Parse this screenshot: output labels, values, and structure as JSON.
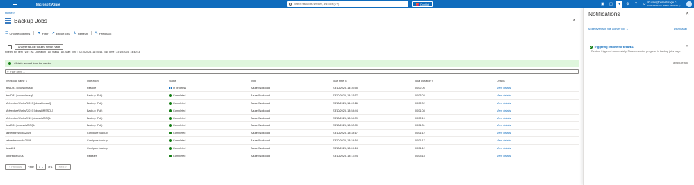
{
  "topbar": {
    "brand": "Microsoft Azure",
    "search_placeholder": "Search resources, services, and docs (G+/)",
    "copilot_label": "Copilot",
    "account_name": "oburski@purestorage.c...",
    "account_org": "PURE STORAGE (PSTSLOMNNTO...)"
  },
  "breadcrumb": "Home >",
  "page": {
    "title": "Backup Jobs",
    "more": "…"
  },
  "toolbar": {
    "choose_columns": "Choose columns",
    "filter": "Filter",
    "export_jobs": "Export jobs",
    "refresh": "Refresh",
    "feedback": "Feedback"
  },
  "analyze_label": "Analyze all Job failures for this vault",
  "filter_summary": "Filtered by: Item Type : All, Operation : All, Status : All, Start Time : 22/10/2025, 14:40:43, End Time : 23/10/2025, 14:40:43",
  "info_message": "All data fetched from the service.",
  "filter_placeholder": "Filter items ...",
  "table": {
    "headers": [
      "Workload name",
      "Operation",
      "Status",
      "Type",
      "Start time",
      "Total Duration",
      "Details"
    ],
    "rows": [
      {
        "name": "testDB1 [oburskimssql]",
        "operation": "Restore",
        "status": "In progress",
        "status_kind": "progress",
        "type": "Azure Workload",
        "start": "23/10/2025, 14:39:55",
        "duration": "00:02:06",
        "details": "View details"
      },
      {
        "name": "testDB1 [oburskimssql]",
        "operation": "Backup (Full)",
        "status": "Completed",
        "status_kind": "ok",
        "type": "Azure Workload",
        "start": "23/10/2025, 14:31:57",
        "duration": "00:03:03",
        "details": "View details"
      },
      {
        "name": "AdventureWorks72019 [oburskimssql]",
        "operation": "Backup (Full)",
        "status": "Completed",
        "status_kind": "ok",
        "type": "Azure Workload",
        "start": "23/10/2025, 14:09:16",
        "duration": "00:02:02",
        "details": "View details"
      },
      {
        "name": "AdventureWorks72019 [oburskiMSSQL]",
        "operation": "Backup (Full)",
        "status": "Completed",
        "status_kind": "ok",
        "type": "Azure Workload",
        "start": "23/10/2025, 13:54:44",
        "duration": "00:01:08",
        "details": "View details"
      },
      {
        "name": "AdventureWorks2019 [oburskiMSSQL]",
        "operation": "Backup (Full)",
        "status": "Completed",
        "status_kind": "ok",
        "type": "Azure Workload",
        "start": "23/10/2025, 13:54:39",
        "duration": "00:02:19",
        "details": "View details"
      },
      {
        "name": "testDB1 [oburskiMSSQL]",
        "operation": "Backup (Full)",
        "status": "Completed",
        "status_kind": "ok",
        "type": "Azure Workload",
        "start": "23/10/2025, 13:50:00",
        "duration": "00:01:31",
        "details": "View details"
      },
      {
        "name": "adventureworks2019",
        "operation": "Configure backup",
        "status": "Completed",
        "status_kind": "ok",
        "type": "Azure Workload",
        "start": "23/10/2025, 13:34:17",
        "duration": "00:01:12",
        "details": "View details"
      },
      {
        "name": "adventureworks2019",
        "operation": "Configure backup",
        "status": "Completed",
        "status_kind": "ok",
        "type": "Azure Workload",
        "start": "23/10/2025, 13:24:14",
        "duration": "00:01:17",
        "details": "View details"
      },
      {
        "name": "testdb1",
        "operation": "Configure backup",
        "status": "Completed",
        "status_kind": "ok",
        "type": "Azure Workload",
        "start": "23/10/2025, 13:24:14",
        "duration": "00:01:12",
        "details": "View details"
      },
      {
        "name": "oburskiMSSQL",
        "operation": "Register",
        "status": "Completed",
        "status_kind": "ok",
        "type": "Azure Workload",
        "start": "23/10/2025, 13:13:44",
        "duration": "00:03:18",
        "details": "View details"
      }
    ]
  },
  "pager": {
    "previous": "< Previous",
    "page_label": "Page",
    "page_value": "1",
    "of_label": "of 1",
    "next": "Next >"
  },
  "notifications": {
    "title": "Notifications",
    "more_events": "More events in the activity log →",
    "dismiss_all": "Dismiss all",
    "items": [
      {
        "title": "Triggering restore for testDB1",
        "body": "Restore triggered successfully. Please monitor progress in backup jobs page.",
        "time": "a minute ago"
      }
    ]
  }
}
